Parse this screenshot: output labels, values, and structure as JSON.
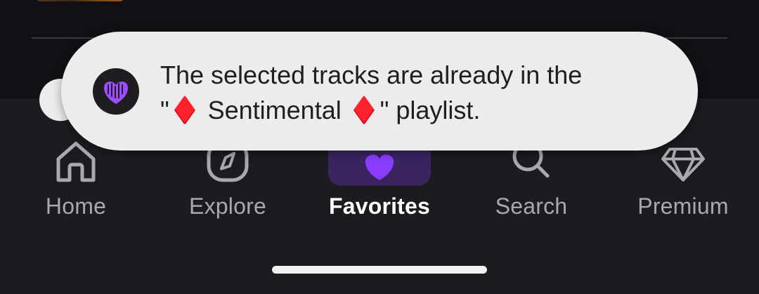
{
  "toast": {
    "line1": "The selected tracks are already in the",
    "quote_open": "\"",
    "gem_left": "♦️",
    "playlist_name": " Sentimental ",
    "gem_right": "♦️",
    "tail": "\" playlist.",
    "logo_icon": "heart-wave-icon"
  },
  "nav": {
    "items": [
      {
        "label": "Home",
        "icon": "house-icon",
        "active": false
      },
      {
        "label": "Explore",
        "icon": "compass-icon",
        "active": false
      },
      {
        "label": "Favorites",
        "icon": "heart-icon",
        "active": true
      },
      {
        "label": "Search",
        "icon": "search-icon",
        "active": false
      },
      {
        "label": "Premium",
        "icon": "diamond-icon",
        "active": false
      }
    ]
  },
  "colors": {
    "accent": "#8b3dff",
    "active_pill": "#3a2561",
    "nav_bg": "#1c1b20",
    "inactive": "#a9a8ae"
  }
}
